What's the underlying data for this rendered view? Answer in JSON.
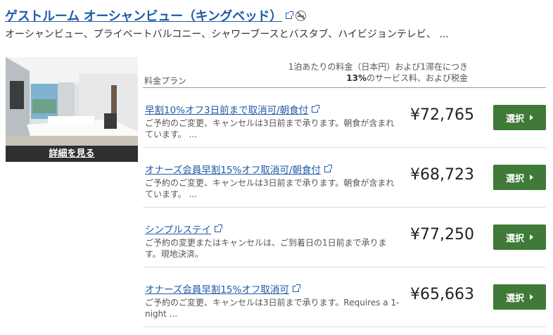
{
  "room": {
    "title": "ゲストルーム オーシャンビュー（キングベッド）",
    "amenities": "オーシャンビュー、プライベートバルコニー、シャワーブースとバスタブ、ハイビジョンテレビ、 ...",
    "details_label": "詳細を見る",
    "link_icon": "external-link-icon",
    "nonsmoking_icon": "no-smoking-icon"
  },
  "header": {
    "plan_label": "料金プラン",
    "rate_line1": "1泊あたりの料金（日本円）および1滞在につき",
    "rate_pct": "13%",
    "rate_line2_rest": "のサービス料、および税金"
  },
  "plans": [
    {
      "name": "早割10%オフ3日前まで取消可/朝食付",
      "desc": "ご予約のご変更、キャンセルは3日前まで承ります。朝食が含まれています。 ...",
      "price": "¥72,765",
      "button": "選択"
    },
    {
      "name": "オナーズ会員早割15%オフ取消可/朝食付",
      "desc": "ご予約のご変更、キャンセルは3日前まで承ります。朝食が含まれています。 ...",
      "price": "¥68,723",
      "button": "選択"
    },
    {
      "name": "シンプルステイ",
      "desc": "ご予約の変更またはキャンセルは、ご到着日の1日前まで承ります。現地決済。",
      "price": "¥77,250",
      "button": "選択"
    },
    {
      "name": "オナーズ会員早割15%オフ取消可",
      "desc": "ご予約のご変更、キャンセルは3日前まで承ります。Requires a 1-night ...",
      "price": "¥65,663",
      "button": "選択"
    }
  ],
  "colors": {
    "link": "#1f5aa8",
    "button": "#3f7a38"
  }
}
